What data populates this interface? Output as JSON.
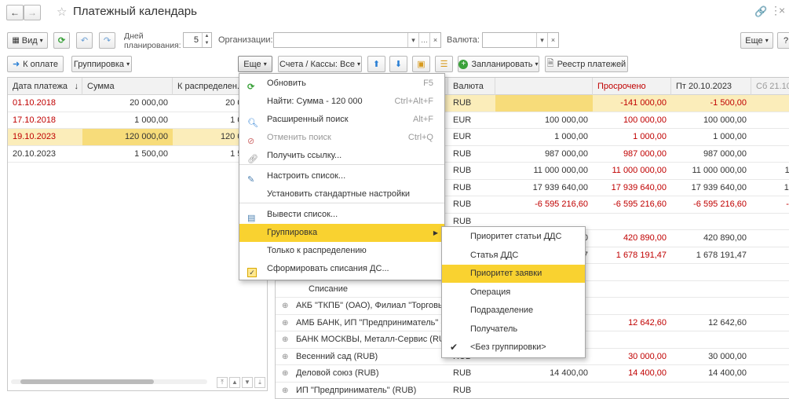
{
  "title": "Платежный календарь",
  "toolbar1": {
    "view_label": "Вид",
    "days_label": "Дней планирования:",
    "days_value": "5",
    "org_label": "Организации:",
    "org_value": "",
    "currency_label": "Валюта:",
    "currency_value": "",
    "more_label": "Еще",
    "help_label": "?"
  },
  "toolbar2": {
    "to_payment": "К оплате",
    "grouping": "Группировка",
    "more": "Еще",
    "accounts": "Счета / Кассы: Все",
    "schedule": "Запланировать",
    "registry": "Реестр платежей"
  },
  "left_table": {
    "headers": [
      "Дата платежа",
      "Сумма",
      "К распределен..."
    ],
    "rows": [
      {
        "date": "01.10.2018",
        "sum": "20 000,00",
        "dist": "20 000,00"
      },
      {
        "date": "17.10.2018",
        "sum": "1 000,00",
        "dist": "1 000,00"
      },
      {
        "date": "19.10.2023",
        "sum": "120 000,00",
        "dist": "120 000,00"
      },
      {
        "date": "20.10.2023",
        "sum": "1 500,00",
        "dist": "1 500,00"
      }
    ]
  },
  "right_table": {
    "headers": [
      "Валюта",
      "",
      "Просрочено",
      "Пт 20.10.2023",
      "Сб 21.10"
    ],
    "rows": [
      {
        "name": "",
        "cur": "RUB",
        "v1": "",
        "v2": "-141 000,00",
        "v3": "-1 500,00",
        "v4": ""
      },
      {
        "name": "",
        "cur": "EUR",
        "v1": "100 000,00",
        "v2": "100 000,00",
        "v3": "100 000,00",
        "v4": ""
      },
      {
        "name": "",
        "cur": "EUR",
        "v1": "1 000,00",
        "v2": "1 000,00",
        "v3": "1 000,00",
        "v4": ""
      },
      {
        "name": "",
        "cur": "RUB",
        "v1": "987 000,00",
        "v2": "987 000,00",
        "v3": "987 000,00",
        "v4": ""
      },
      {
        "name": "",
        "cur": "RUB",
        "v1": "11 000 000,00",
        "v2": "11 000 000,00",
        "v3": "11 000 000,00",
        "v4": "11"
      },
      {
        "name": "",
        "cur": "RUB",
        "v1": "17 939 640,00",
        "v2": "17 939 640,00",
        "v3": "17 939 640,00",
        "v4": "17"
      },
      {
        "name": "",
        "cur": "RUB",
        "v1": "-6 595 216,60",
        "v2": "-6 595 216,60",
        "v3": "-6 595 216,60",
        "v4": "-6"
      },
      {
        "name": "",
        "cur": "RUB",
        "v1": "",
        "v2": "",
        "v3": "",
        "v4": ""
      },
      {
        "name": "",
        "cur": "",
        "v1": "0",
        "v2": "420 890,00",
        "v3": "420 890,00",
        "v4": ""
      },
      {
        "name": "",
        "cur": "",
        "v1": "7",
        "v2": "1 678 191,47",
        "v3": "1 678 191,47",
        "v4": "1"
      },
      {
        "name": "",
        "cur": "",
        "v1": "",
        "v2": "",
        "v3": "",
        "v4": ""
      },
      {
        "name": "Списание",
        "cur": "",
        "v1": "",
        "v2": "",
        "v3": "",
        "v4": ""
      },
      {
        "name": "АКБ \"ТКПБ\" (ОАО), Филиал \"Торговый...",
        "cur": "",
        "v1": "",
        "v2": "",
        "v3": "",
        "v4": ""
      },
      {
        "name": "АМБ БАНК, ИП \"Предприниматель\" (R...",
        "cur": "",
        "v1": "",
        "v2": "12 642,60",
        "v3": "12 642,60",
        "v4": ""
      },
      {
        "name": "БАНК МОСКВЫ, Металл-Сервис (RUB)",
        "cur": "",
        "v1": "",
        "v2": "",
        "v3": "",
        "v4": ""
      },
      {
        "name": "Весенний сад (RUB)",
        "cur": "RUB",
        "v1": "",
        "v2": "30 000,00",
        "v3": "30 000,00",
        "v4": ""
      },
      {
        "name": "Деловой союз (RUB)",
        "cur": "RUB",
        "v1": "14 400,00",
        "v2": "14 400,00",
        "v3": "14 400,00",
        "v4": ""
      },
      {
        "name": "ИП \"Предприниматель\" (RUB)",
        "cur": "RUB",
        "v1": "",
        "v2": "",
        "v3": "",
        "v4": ""
      }
    ]
  },
  "more_menu": [
    {
      "label": "Обновить",
      "shortcut": "F5",
      "icon": "refresh-icon"
    },
    {
      "label": "Найти: Сумма - 120 000",
      "shortcut": "Ctrl+Alt+F",
      "icon": ""
    },
    {
      "label": "Расширенный поиск",
      "shortcut": "Alt+F",
      "icon": "search-icon"
    },
    {
      "label": "Отменить поиск",
      "shortcut": "Ctrl+Q",
      "icon": "cancel-search-icon"
    },
    {
      "label": "Получить ссылку...",
      "shortcut": "",
      "icon": "link-icon"
    },
    {
      "label": "Настроить список...",
      "shortcut": "",
      "icon": "settings-list-icon"
    },
    {
      "label": "Установить стандартные настройки",
      "shortcut": "",
      "icon": ""
    },
    {
      "label": "Вывести список...",
      "shortcut": "",
      "icon": "print-list-icon"
    },
    {
      "label": "Группировка",
      "shortcut": "",
      "icon": ""
    },
    {
      "label": "Только к распределению",
      "shortcut": "",
      "icon": ""
    },
    {
      "label": "Сформировать списания ДС...",
      "shortcut": "",
      "icon": "checkbox-icon"
    }
  ],
  "group_menu": [
    "Приоритет статьи ДДС",
    "Статья ДДС",
    "Приоритет заявки",
    "Операция",
    "Подразделение",
    "Получатель",
    "<Без группировки>"
  ],
  "colors": {
    "highlight": "#f9d230",
    "selected_row": "#fbedba",
    "red": "#c00000",
    "accent_green": "#3aa13a",
    "accent_blue": "#2a7fd4"
  }
}
